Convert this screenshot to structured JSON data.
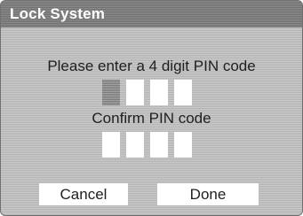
{
  "dialog": {
    "title": "Lock System",
    "enter_prompt": "Please enter a 4 digit PIN code",
    "confirm_prompt": "Confirm PIN code",
    "pin_entry": {
      "digits": 4,
      "filled": 0,
      "active_index": 0
    },
    "pin_confirm": {
      "digits": 4,
      "filled": 0
    }
  },
  "buttons": {
    "cancel_label": "Cancel",
    "done_label": "Done"
  }
}
